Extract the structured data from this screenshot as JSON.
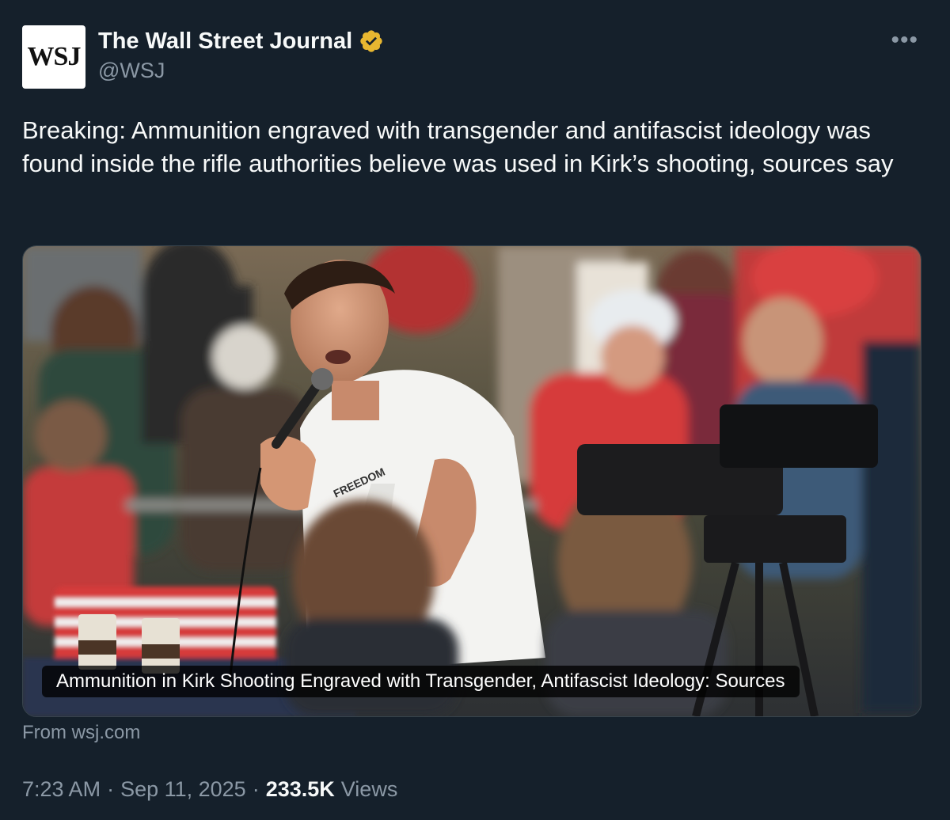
{
  "author": {
    "avatar_text": "WSJ",
    "display_name": "The Wall Street Journal",
    "handle": "@WSJ",
    "verified_icon": "verified-badge-gold-icon"
  },
  "more_icon_label": "•••",
  "tweet": {
    "text": "Breaking: Ammunition engraved with transgender and antifascist ideology was found inside the rifle authorities believe was used in Kirk’s shooting, sources say"
  },
  "card": {
    "caption": "Ammunition in Kirk Shooting Engraved with Transgender, Antifascist Ideology: Sources",
    "shirt_text": "FREEDOM",
    "source": "From wsj.com"
  },
  "meta": {
    "time": "7:23 AM",
    "separator": "·",
    "date": "Sep 11, 2025",
    "views_count": "233.5K",
    "views_label": "Views"
  },
  "colors": {
    "background": "#15202b",
    "text": "#f7f9f9",
    "secondary_text": "#8b98a5",
    "verified_gold": "#e8b730",
    "border": "#38444d"
  }
}
